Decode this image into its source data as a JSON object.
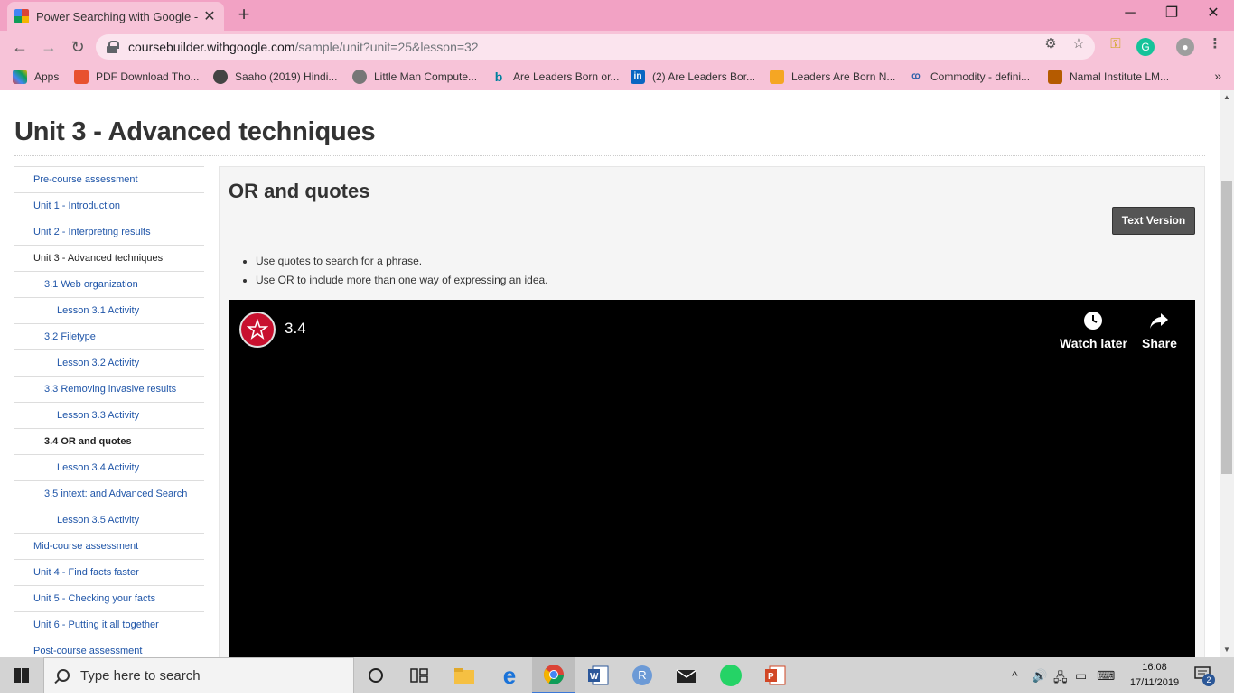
{
  "browser": {
    "tab_title": "Power Searching with Google -",
    "url_host": "coursebuilder.withgoogle.com",
    "url_path": "/sample/unit?unit=25&lesson=32",
    "bookmarks": [
      {
        "label": "Apps",
        "icon": "apps-grid-icon"
      },
      {
        "label": "PDF Download Tho...",
        "icon": "pdf-icon"
      },
      {
        "label": "Saaho (2019) Hindi...",
        "icon": "film-reel-icon"
      },
      {
        "label": "Little Man Compute...",
        "icon": "globe-icon"
      },
      {
        "label": "Are Leaders Born or...",
        "icon": "bing-icon"
      },
      {
        "label": "(2) Are Leaders Bor...",
        "icon": "linkedin-icon"
      },
      {
        "label": "Leaders Are Born N...",
        "icon": "bookmark-page-icon"
      },
      {
        "label": "Commodity - defini...",
        "icon": "investopedia-icon"
      },
      {
        "label": "Namal Institute LM...",
        "icon": "graduation-cap-icon"
      }
    ],
    "bookmarks_overflow": "»"
  },
  "page": {
    "unit_title": "Unit 3 - Advanced techniques",
    "nav": [
      {
        "label": "Pre-course assessment",
        "level": 0
      },
      {
        "label": "Unit 1 - Introduction",
        "level": 0
      },
      {
        "label": "Unit 2 - Interpreting results",
        "level": 0
      },
      {
        "label": "Unit 3 - Advanced techniques",
        "level": 0,
        "state": "current"
      },
      {
        "label": "3.1 Web organization",
        "level": 1
      },
      {
        "label": "Lesson 3.1 Activity",
        "level": 2
      },
      {
        "label": "3.2 Filetype",
        "level": 1
      },
      {
        "label": "Lesson 3.2 Activity",
        "level": 2
      },
      {
        "label": "3.3 Removing invasive results",
        "level": 1
      },
      {
        "label": "Lesson 3.3 Activity",
        "level": 2
      },
      {
        "label": "3.4 OR and quotes",
        "level": 1,
        "state": "active"
      },
      {
        "label": "Lesson 3.4 Activity",
        "level": 2
      },
      {
        "label": "3.5 intext: and Advanced Search",
        "level": 1
      },
      {
        "label": "Lesson 3.5 Activity",
        "level": 2
      },
      {
        "label": "Mid-course assessment",
        "level": 0
      },
      {
        "label": "Unit 4 - Find facts faster",
        "level": 0
      },
      {
        "label": "Unit 5 - Checking your facts",
        "level": 0
      },
      {
        "label": "Unit 6 - Putting it all together",
        "level": 0
      },
      {
        "label": "Post-course assessment",
        "level": 0
      }
    ],
    "lesson_title": "OR and quotes",
    "text_version_label": "Text Version",
    "bullets": [
      "Use quotes to search for a phrase.",
      "Use OR to include more than one way of expressing an idea."
    ],
    "video": {
      "title": "3.4",
      "watch_later_label": "Watch later",
      "share_label": "Share"
    }
  },
  "taskbar": {
    "search_placeholder": "Type here to search",
    "time": "16:08",
    "date": "17/11/2019",
    "notification_count": "2"
  },
  "colors": {
    "chrome_pink": "#f2a2c4",
    "link_blue": "#1f55a8",
    "video_bg": "#000000",
    "logo_red": "#c8102e"
  }
}
